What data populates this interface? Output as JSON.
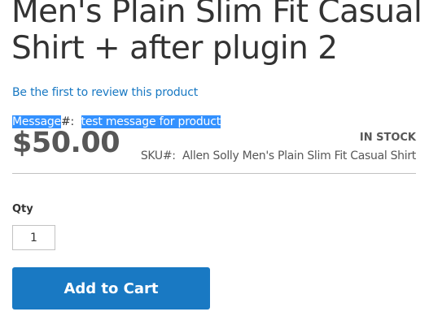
{
  "product": {
    "title": "Men's Plain Slim Fit Casual Shirt + after plugin 2",
    "review_link": "Be the first to review this product",
    "message_label": "Message",
    "message_separator": "#:  ",
    "message_value": "test message for product",
    "price": "$50.00",
    "stock_status": "IN STOCK",
    "sku_label": "SKU#:  ",
    "sku_value": "Allen Solly Men's Plain Slim Fit Casual Shirt"
  },
  "cart": {
    "qty_label": "Qty",
    "qty_value": "1",
    "add_to_cart_label": "Add to Cart"
  },
  "colors": {
    "accent": "#1979c3",
    "selection": "#3391ff",
    "price": "#575757"
  }
}
